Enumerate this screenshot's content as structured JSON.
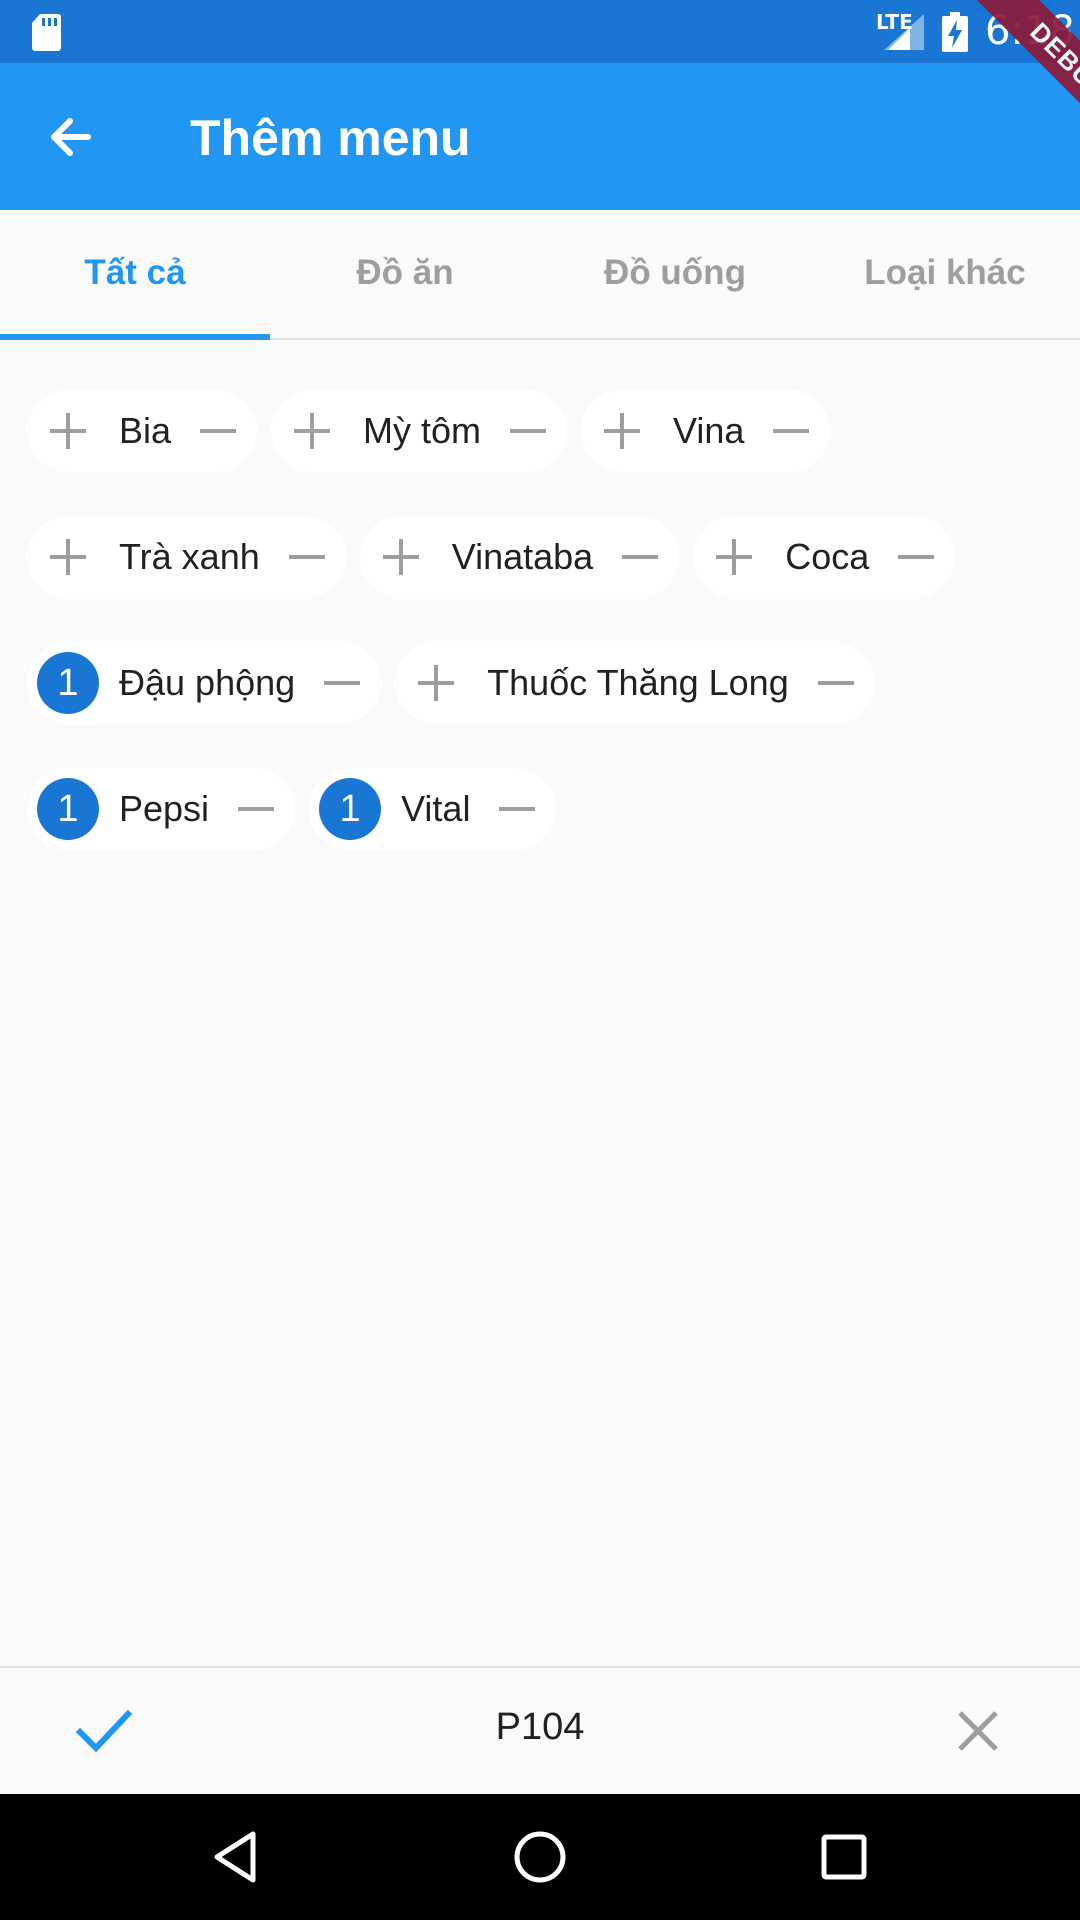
{
  "status_bar": {
    "network": "LTE",
    "time": "6:18",
    "icons": [
      "sd-card-icon",
      "signal-icon",
      "battery-charging-icon"
    ]
  },
  "debug_banner": "DEBUG",
  "app_bar": {
    "title": "Thêm menu",
    "back_icon": "arrow-back-icon"
  },
  "tabs": [
    {
      "label": "Tất cả",
      "active": true
    },
    {
      "label": "Đồ ăn",
      "active": false
    },
    {
      "label": "Đồ uống",
      "active": false
    },
    {
      "label": "Loại khác",
      "active": false
    }
  ],
  "items": {
    "bia": {
      "label": "Bia",
      "count": null
    },
    "my_tom": {
      "label": "Mỳ tôm",
      "count": null
    },
    "vina": {
      "label": "Vina",
      "count": null
    },
    "tra_xanh": {
      "label": "Trà xanh",
      "count": null
    },
    "vinataba": {
      "label": "Vinataba",
      "count": null
    },
    "coca": {
      "label": "Coca",
      "count": null
    },
    "dau_phong": {
      "label": "Đậu phộng",
      "count": "1"
    },
    "thuoc_thang_long": {
      "label": "Thuốc Thăng Long",
      "count": null
    },
    "pepsi": {
      "label": "Pepsi",
      "count": "1"
    },
    "vital": {
      "label": "Vital",
      "count": "1"
    }
  },
  "bottom_bar": {
    "room": "P104",
    "confirm_icon": "check-icon",
    "cancel_icon": "close-icon"
  },
  "colors": {
    "primary": "#2196f3",
    "primary_dark": "#1976d2",
    "background": "#fafafa",
    "chip_background": "#ffffff",
    "icon_grey": "#9e9e9e"
  }
}
